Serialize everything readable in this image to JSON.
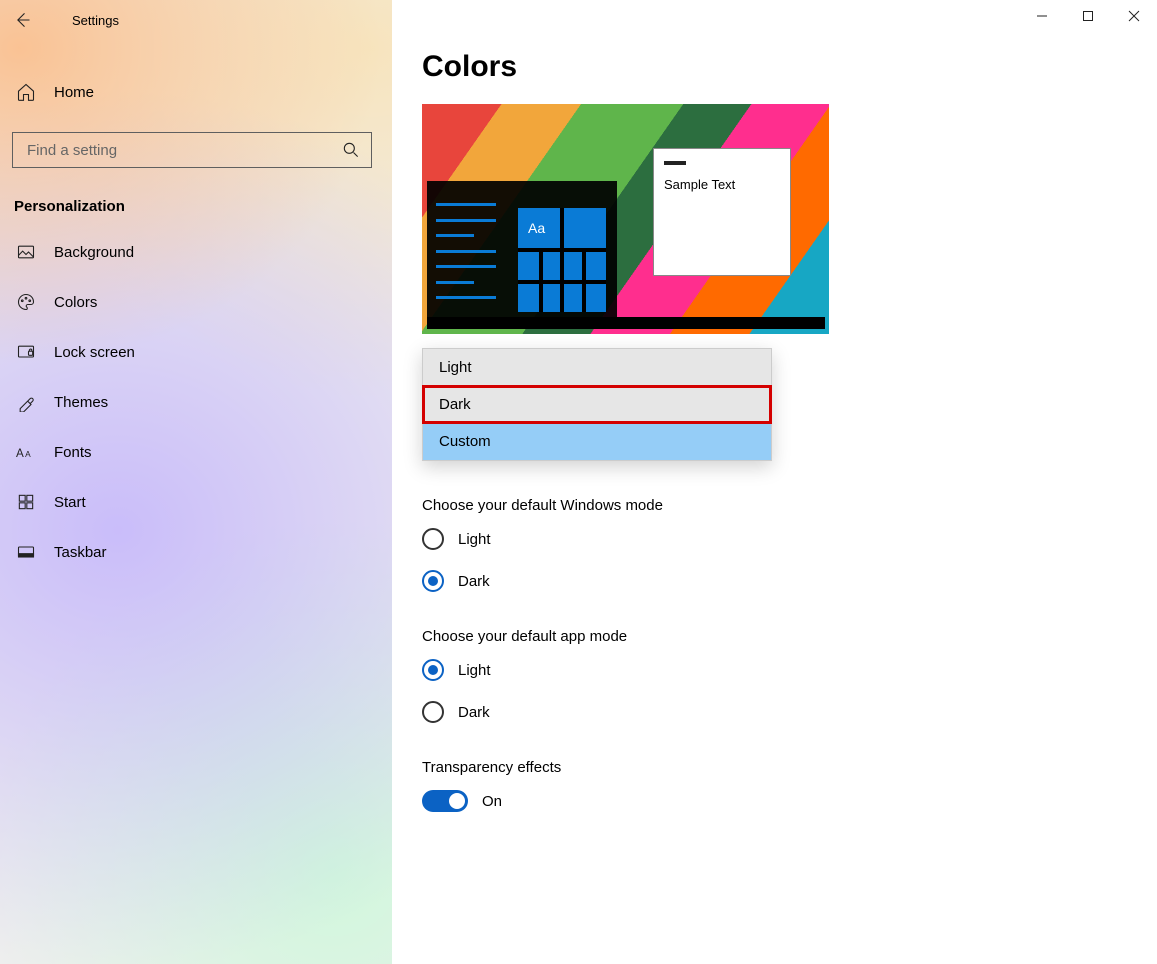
{
  "window": {
    "title": "Settings"
  },
  "home_label": "Home",
  "search": {
    "placeholder": "Find a setting"
  },
  "section_title": "Personalization",
  "nav": [
    {
      "label": "Background"
    },
    {
      "label": "Colors"
    },
    {
      "label": "Lock screen"
    },
    {
      "label": "Themes"
    },
    {
      "label": "Fonts"
    },
    {
      "label": "Start"
    },
    {
      "label": "Taskbar"
    }
  ],
  "page_title": "Colors",
  "preview": {
    "sample_text": "Sample Text",
    "aa": "Aa"
  },
  "color_mode_dropdown": {
    "options": [
      "Light",
      "Dark",
      "Custom"
    ],
    "selected": "Custom",
    "highlighted": "Dark"
  },
  "windows_mode": {
    "heading": "Choose your default Windows mode",
    "options": [
      "Light",
      "Dark"
    ],
    "selected": "Dark"
  },
  "app_mode": {
    "heading": "Choose your default app mode",
    "options": [
      "Light",
      "Dark"
    ],
    "selected": "Light"
  },
  "transparency": {
    "heading": "Transparency effects",
    "state_label": "On",
    "on": true
  }
}
